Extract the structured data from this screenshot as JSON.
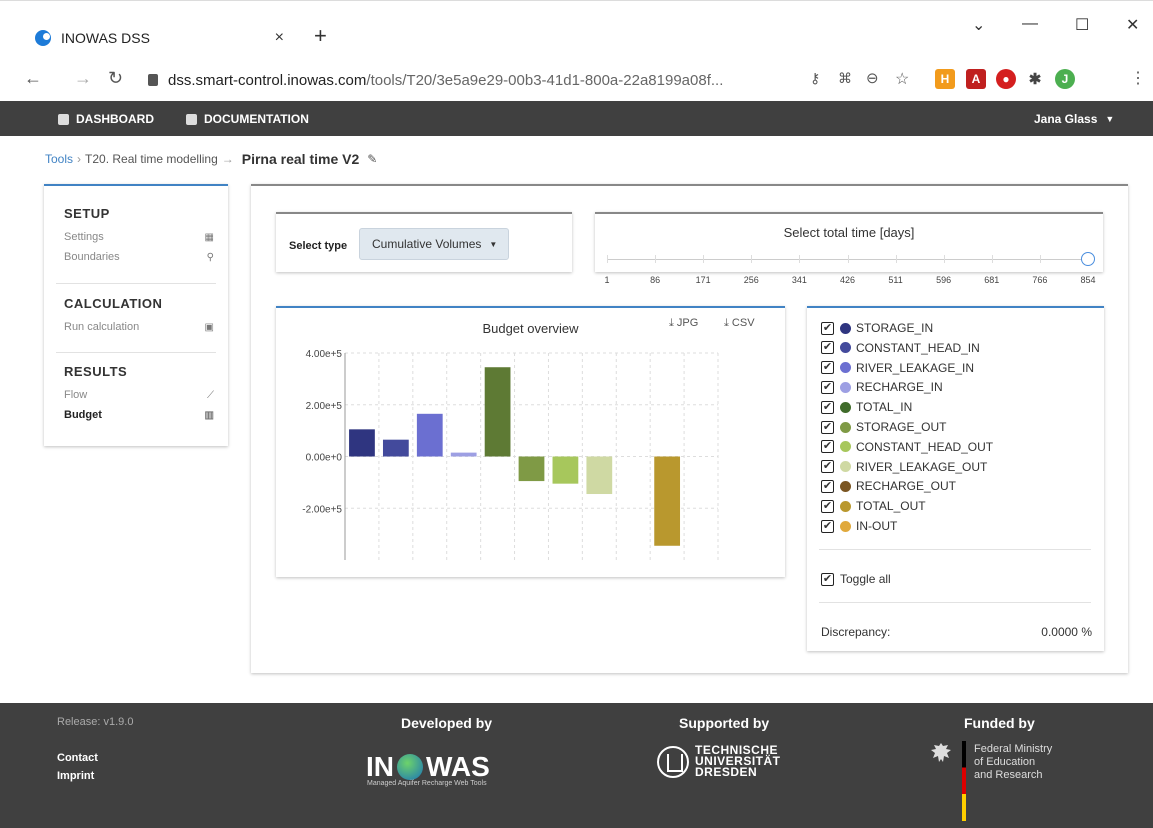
{
  "browser": {
    "tab_title": "INOWAS DSS",
    "tab_close": "×",
    "new_tab": "+",
    "url_host": "dss.smart-control.inowas.com",
    "url_path": "/tools/T20/3e5a9e29-00b3-41d1-800a-22a8199a08f...",
    "profile_initial": "J"
  },
  "topnav": {
    "dashboard": "DASHBOARD",
    "documentation": "DOCUMENTATION",
    "user": "Jana Glass"
  },
  "breadcrumb": {
    "tools": "Tools",
    "t20": "T20. Real time modelling",
    "current": "Pirna real time V2"
  },
  "sidebar": {
    "setup": {
      "title": "SETUP",
      "items": [
        "Settings",
        "Boundaries"
      ]
    },
    "calculation": {
      "title": "CALCULATION",
      "items": [
        "Run calculation"
      ]
    },
    "results": {
      "title": "RESULTS",
      "items": [
        "Flow",
        "Budget"
      ]
    }
  },
  "select_type": {
    "label": "Select type",
    "value": "Cumulative Volumes"
  },
  "time_slider": {
    "title": "Select total time [days]",
    "ticks": [
      "1",
      "86",
      "171",
      "256",
      "341",
      "426",
      "511",
      "596",
      "681",
      "766",
      "854"
    ],
    "value": "854"
  },
  "chart_header": {
    "title": "Budget overview",
    "jpg": "JPG",
    "csv": "CSV"
  },
  "chart_data": {
    "type": "bar",
    "title": "Budget overview",
    "categories": [
      "STORAGE_IN",
      "CONSTANT_HEAD_IN",
      "RIVER_LEAKAGE_IN",
      "RECHARGE_IN",
      "TOTAL_IN",
      "STORAGE_OUT",
      "CONSTANT_HEAD_OUT",
      "RIVER_LEAKAGE_OUT",
      "RECHARGE_OUT",
      "TOTAL_OUT",
      "IN-OUT"
    ],
    "values": [
      105000,
      65000,
      165000,
      15000,
      345000,
      -95000,
      -105000,
      -145000,
      0,
      -345000,
      0
    ],
    "colors": [
      "#2f3580",
      "#434a9c",
      "#6b6fd1",
      "#9d9fe3",
      "#5e7a34",
      "#7f9a45",
      "#a7c75c",
      "#cfd9a3",
      "#7a5522",
      "#b9982e",
      "#e0a93c"
    ],
    "yticks": [
      "4.00e+5",
      "2.00e+5",
      "0.00e+0",
      "-2.00e+5"
    ],
    "ylim": [
      -400000,
      400000
    ],
    "xlabel": "",
    "ylabel": ""
  },
  "legend": {
    "items": [
      {
        "name": "STORAGE_IN",
        "color": "#2f3580"
      },
      {
        "name": "CONSTANT_HEAD_IN",
        "color": "#434a9c"
      },
      {
        "name": "RIVER_LEAKAGE_IN",
        "color": "#6b6fd1"
      },
      {
        "name": "RECHARGE_IN",
        "color": "#9d9fe3"
      },
      {
        "name": "TOTAL_IN",
        "color": "#3f6b2a"
      },
      {
        "name": "STORAGE_OUT",
        "color": "#7f9a45"
      },
      {
        "name": "CONSTANT_HEAD_OUT",
        "color": "#a7c75c"
      },
      {
        "name": "RIVER_LEAKAGE_OUT",
        "color": "#cfd9a3"
      },
      {
        "name": "RECHARGE_OUT",
        "color": "#7a5522"
      },
      {
        "name": "TOTAL_OUT",
        "color": "#b9982e"
      },
      {
        "name": "IN-OUT",
        "color": "#e0a93c"
      }
    ],
    "toggle_all": "Toggle all",
    "discrepancy_label": "Discrepancy:",
    "discrepancy_value": "0.0000 %"
  },
  "footer": {
    "release": "Release: v1.9.0",
    "contact": "Contact",
    "imprint": "Imprint",
    "developed_by": "Developed by",
    "supported_by": "Supported by",
    "funded_by": "Funded by",
    "inowas_left": "IN",
    "inowas_right": "WAS",
    "inowas_sub": "Managed Aquifer Recharge Web Tools",
    "tud_1": "TECHNISCHE",
    "tud_2": "UNIVERSITÄT",
    "tud_3": "DRESDEN",
    "bmbf_1": "Federal Ministry",
    "bmbf_2": "of Education",
    "bmbf_3": "and Research"
  }
}
